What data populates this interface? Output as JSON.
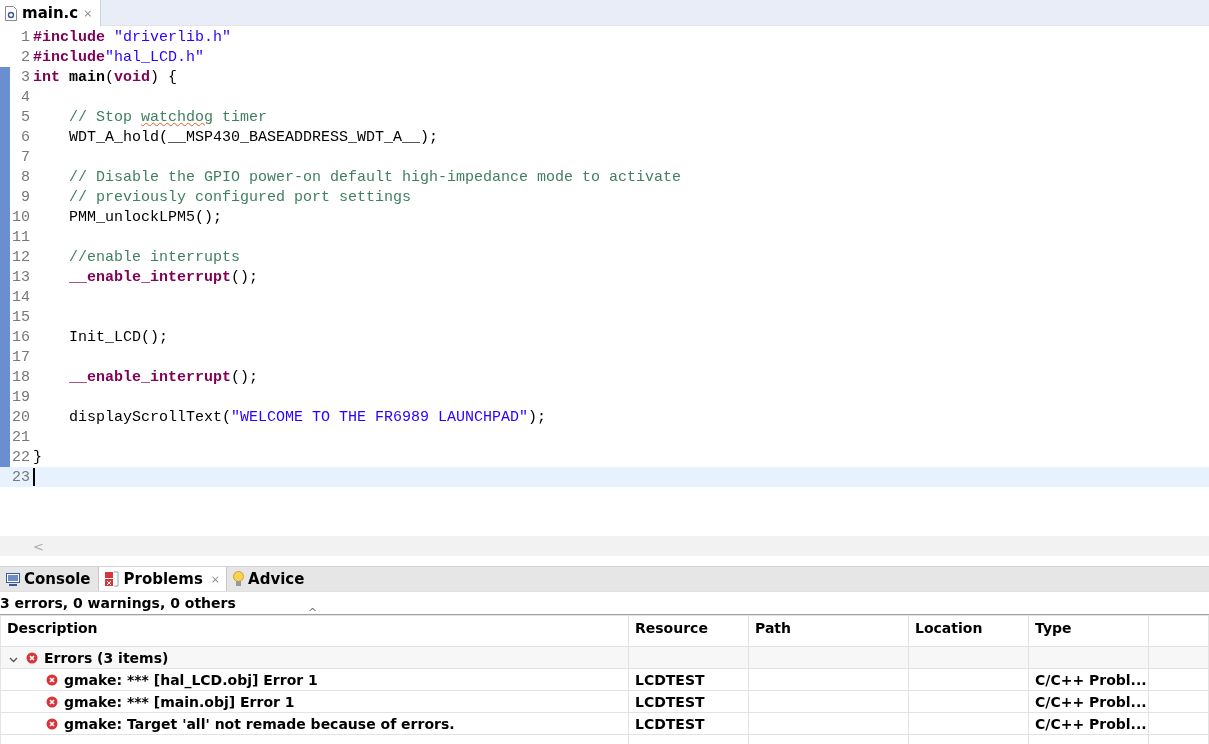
{
  "editor_tab": {
    "title": "main.c",
    "close": "⨯"
  },
  "code": [
    {
      "number": "1",
      "tokens": [
        {
          "kind": "keyword",
          "text": "#include"
        },
        {
          "kind": "string",
          "text": " \"driverlib.h\""
        }
      ]
    },
    {
      "number": "2",
      "tokens": [
        {
          "kind": "keyword",
          "text": "#include"
        },
        {
          "kind": "string",
          "text": "\"hal_LCD.h\""
        }
      ]
    },
    {
      "number": "3",
      "modified": true,
      "tokens": [
        {
          "kind": "keyword",
          "text": "int"
        },
        {
          "kind": "bold",
          "text": " main"
        },
        {
          "kind": "plain",
          "text": "("
        },
        {
          "kind": "keyword",
          "text": "void"
        },
        {
          "kind": "plain",
          "text": ") {"
        }
      ]
    },
    {
      "number": "4",
      "modified": true
    },
    {
      "number": "5",
      "indent": true,
      "modified": true,
      "tokens": [
        {
          "kind": "comment",
          "text": "// Stop "
        },
        {
          "kind": "misspelled",
          "text": "watchdog"
        },
        {
          "kind": "comment",
          "text": " timer"
        }
      ]
    },
    {
      "number": "6",
      "indent": true,
      "modified": true,
      "tokens": [
        {
          "kind": "plain",
          "text": "WDT_A_hold(__MSP430_BASEADDRESS_WDT_A__);"
        }
      ]
    },
    {
      "number": "7",
      "modified": true
    },
    {
      "number": "8",
      "indent": true,
      "modified": true,
      "tokens": [
        {
          "kind": "comment",
          "text": "// Disable the GPIO power-on default high-impedance mode to activate"
        }
      ]
    },
    {
      "number": "9",
      "indent": true,
      "modified": true,
      "tokens": [
        {
          "kind": "comment",
          "text": "// previously configured port settings"
        }
      ]
    },
    {
      "number": "10",
      "indent": true,
      "modified": true,
      "tokens": [
        {
          "kind": "plain",
          "text": "PMM_unlockLPM5();"
        }
      ]
    },
    {
      "number": "11",
      "modified": true
    },
    {
      "number": "12",
      "indent": true,
      "modified": true,
      "tokens": [
        {
          "kind": "comment",
          "text": "//enable interrupts"
        }
      ]
    },
    {
      "number": "13",
      "indent": true,
      "modified": true,
      "tokens": [
        {
          "kind": "keyword",
          "text": "__enable_interrupt"
        },
        {
          "kind": "plain",
          "text": "();"
        }
      ]
    },
    {
      "number": "14",
      "modified": true
    },
    {
      "number": "15",
      "modified": true
    },
    {
      "number": "16",
      "indent": true,
      "modified": true,
      "tokens": [
        {
          "kind": "plain",
          "text": "Init_LCD();"
        }
      ]
    },
    {
      "number": "17",
      "modified": true
    },
    {
      "number": "18",
      "indent": true,
      "modified": true,
      "tokens": [
        {
          "kind": "keyword",
          "text": "__enable_interrupt"
        },
        {
          "kind": "plain",
          "text": "();"
        }
      ]
    },
    {
      "number": "19",
      "modified": true
    },
    {
      "number": "20",
      "indent": true,
      "modified": true,
      "tokens": [
        {
          "kind": "plain",
          "text": "displayScrollText("
        },
        {
          "kind": "string",
          "text": "\"WELCOME TO THE FR6989 LAUNCHPAD\""
        },
        {
          "kind": "plain",
          "text": ");"
        }
      ]
    },
    {
      "number": "21",
      "modified": true
    },
    {
      "number": "22",
      "modified": true,
      "tokens": [
        {
          "kind": "plain",
          "text": "}"
        }
      ]
    },
    {
      "number": "23",
      "current": true
    }
  ],
  "scroll_arrow": "<",
  "panel_tabs": [
    {
      "kind": "console",
      "label": "Console",
      "selected": false
    },
    {
      "kind": "problems",
      "label": "Problems",
      "selected": true,
      "close": "⨯"
    },
    {
      "kind": "advice",
      "label": "Advice",
      "selected": false
    }
  ],
  "summary": "3 errors, 0 warnings, 0 others",
  "sort_indicator": "^",
  "table": {
    "columns": [
      "Description",
      "Resource",
      "Path",
      "Location",
      "Type"
    ],
    "group": {
      "label": "Errors (3 items)",
      "expanded": true
    },
    "rows": [
      {
        "description": "gmake: *** [hal_LCD.obj] Error 1",
        "resource": "LCDTEST",
        "type": "C/C++ Probl..."
      },
      {
        "description": "gmake: *** [main.obj] Error 1",
        "resource": "LCDTEST",
        "type": "C/C++ Probl..."
      },
      {
        "description": "gmake: Target 'all' not remade because of errors.",
        "resource": "LCDTEST",
        "type": "C/C++ Probl..."
      }
    ]
  }
}
